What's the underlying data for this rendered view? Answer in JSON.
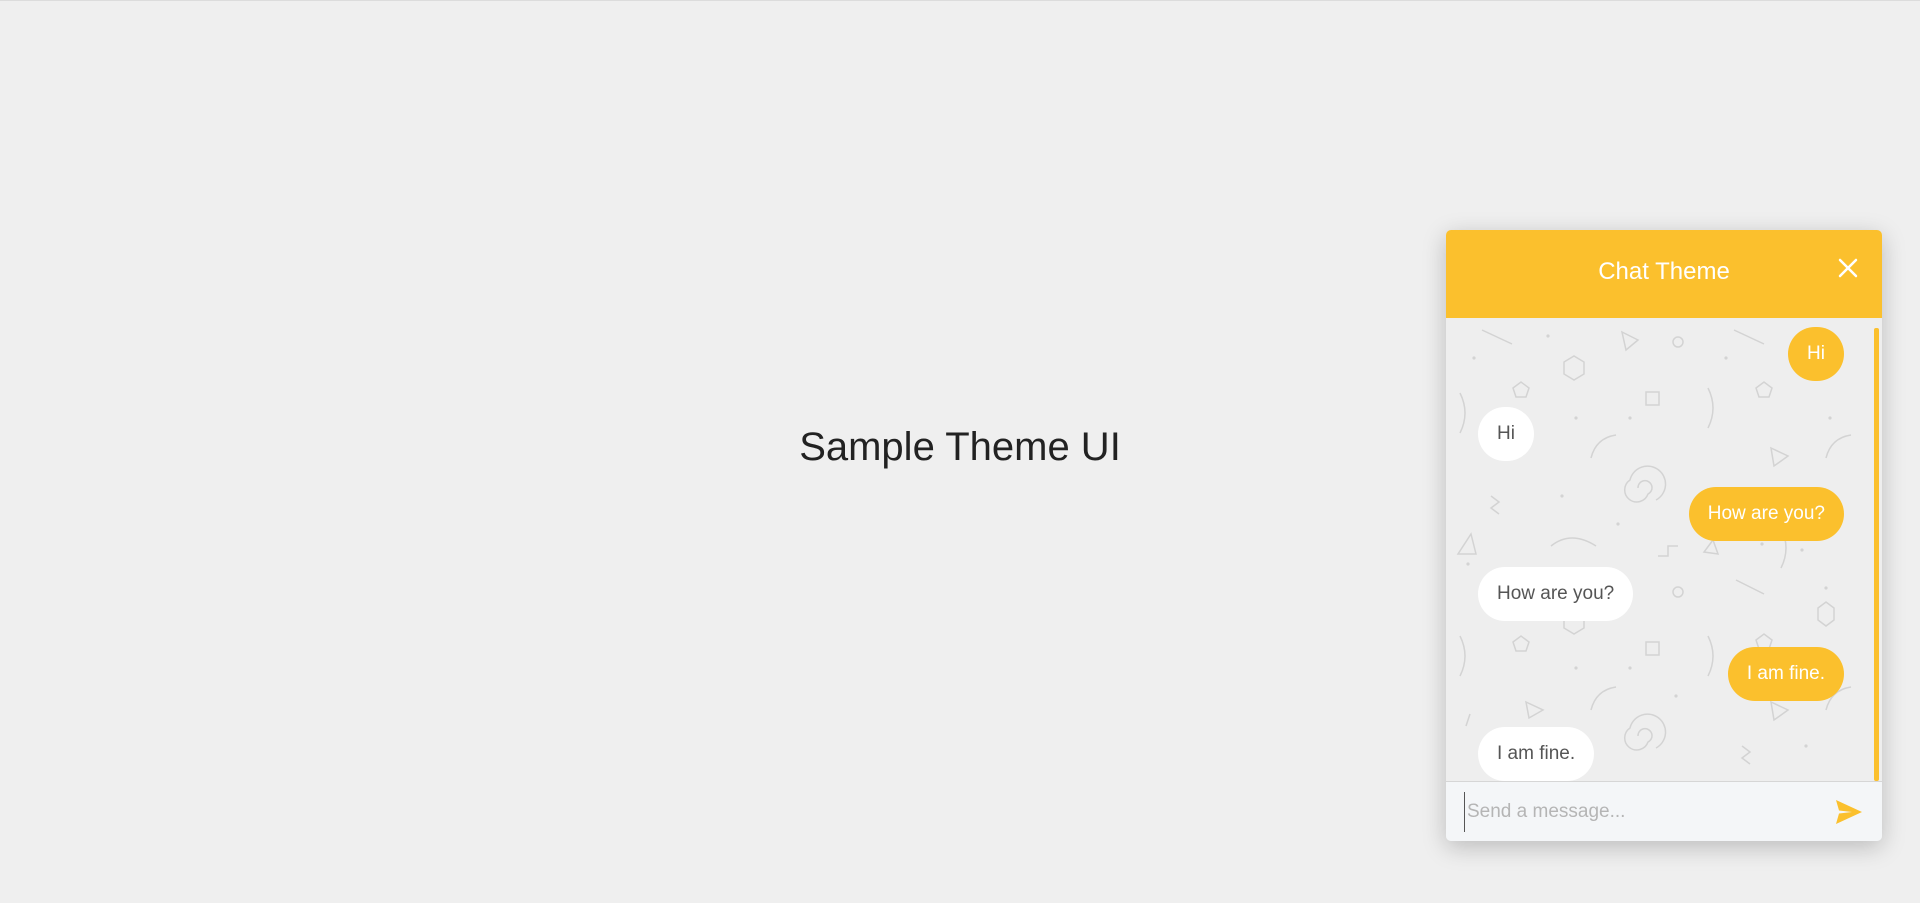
{
  "page": {
    "title": "Sample Theme UI"
  },
  "chat": {
    "title": "Chat Theme",
    "accent_color": "#fbc02d",
    "close_icon": "close-icon",
    "send_icon": "send-icon",
    "input_placeholder": "Send a message...",
    "input_value": "",
    "messages": [
      {
        "direction": "outgoing",
        "text": "Hi"
      },
      {
        "direction": "incoming",
        "text": "Hi"
      },
      {
        "direction": "outgoing",
        "text": "How are you?"
      },
      {
        "direction": "incoming",
        "text": "How are you?"
      },
      {
        "direction": "outgoing",
        "text": "I am fine."
      },
      {
        "direction": "incoming",
        "text": "I am fine."
      }
    ]
  }
}
